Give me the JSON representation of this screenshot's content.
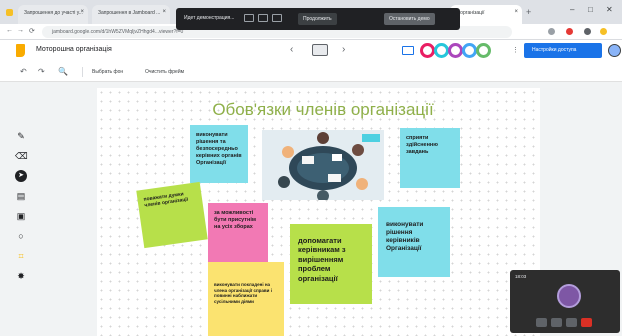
{
  "browser": {
    "tabs": [
      {
        "label": "Запрошення до участі у..."
      },
      {
        "label": "Запрошення в Jamboard ..."
      },
      {
        "label": "...організації"
      }
    ],
    "window_controls": [
      "–",
      "□",
      "✕"
    ],
    "address": "jamboard.google.com/d/1hW5ZVMqIjvZHhgd4...viewer?f=0",
    "nav": {
      "back": "←",
      "forward": "→",
      "reload": "⟳"
    }
  },
  "share_bar": {
    "title": "Идет демонстрация...",
    "continue_label": "Продолжить",
    "stop_label": "Остановить демо"
  },
  "jamboard": {
    "doc_title": "Моторошна організація",
    "frame_prev": "‹",
    "frame_next": "›",
    "share_button": "Настройки доступа",
    "toolbar": {
      "undo": "↶",
      "redo": "↷",
      "zoom": "🔍",
      "set_background": "Выбрать фон",
      "clear_frame": "Очистить фрейм"
    },
    "left_tools": [
      "✎",
      "⌫",
      "➤",
      "▤",
      "▣",
      "○",
      "⌗",
      "✸"
    ]
  },
  "canvas": {
    "title": "Обов'язки членів організації",
    "notes": {
      "n1": "виконувати рішення та безпосередньо керівних органів Організації",
      "n2": "сприяти здійсненню завдань",
      "n3": "поважати думки членів організації",
      "n4": "за можливості бути присутнім на усіх зборах",
      "n5": "допомагати керівникам з вирішенням проблем організації",
      "n6": "виконувати рішення керівників Організації",
      "n7": "виконувати покладені на члена організації справи і повинні наближати сусільними діями"
    }
  },
  "video": {
    "label": "18:03"
  },
  "colors": {
    "accent_blue": "#1a73e8",
    "title_green": "#8fb04a",
    "note_cyan": "#80deea",
    "note_green": "#b7e04a",
    "note_pink": "#f279b4",
    "note_yellow": "#fbe370"
  }
}
